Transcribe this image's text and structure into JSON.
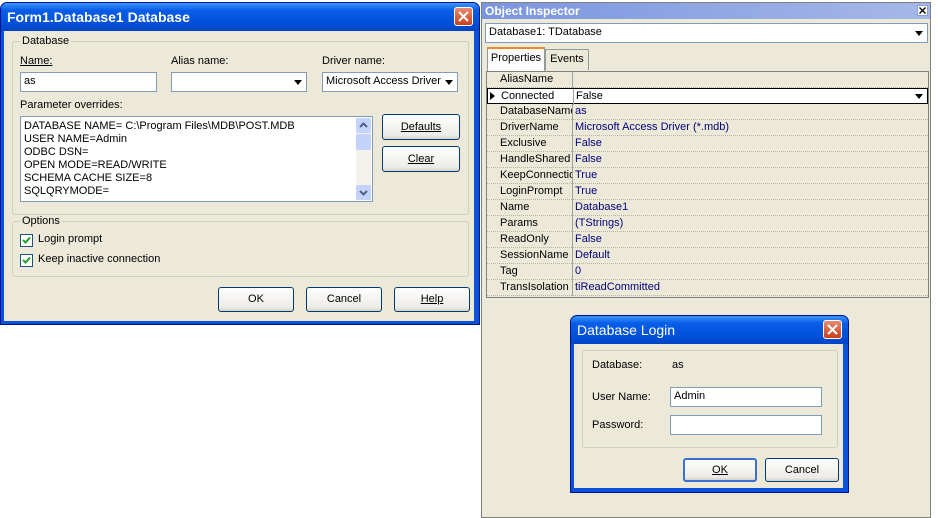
{
  "db_dialog": {
    "title": "Form1.Database1 Database",
    "group_database": "Database",
    "name_label": "Name:",
    "name_value": "as",
    "alias_label": "Alias name:",
    "alias_value": "",
    "driver_label": "Driver name:",
    "driver_value": "Microsoft Access Driver",
    "params_label": "Parameter overrides:",
    "params_lines": [
      "DATABASE NAME= C:\\Program Files\\MDB\\POST.MDB",
      "USER NAME=Admin",
      "ODBC DSN=",
      "OPEN MODE=READ/WRITE",
      "SCHEMA CACHE SIZE=8",
      "SQLQRYMODE="
    ],
    "defaults_label": "Defaults",
    "clear_label": "Clear",
    "group_options": "Options",
    "login_prompt_label": "Login prompt",
    "login_prompt_checked": true,
    "keep_inactive_label": "Keep inactive connection",
    "keep_inactive_checked": true,
    "ok_label": "OK",
    "cancel_label": "Cancel",
    "help_label": "Help"
  },
  "object_inspector": {
    "title": "Object Inspector",
    "component": "Database1: TDatabase",
    "tabs": [
      "Properties",
      "Events"
    ],
    "properties": [
      {
        "name": "AliasName",
        "value": ""
      },
      {
        "name": "Connected",
        "value": "False"
      },
      {
        "name": "DatabaseName",
        "value": "as"
      },
      {
        "name": "DriverName",
        "value": "Microsoft Access Driver (*.mdb)"
      },
      {
        "name": "Exclusive",
        "value": "False"
      },
      {
        "name": "HandleShared",
        "value": "False"
      },
      {
        "name": "KeepConnection",
        "value": "True"
      },
      {
        "name": "LoginPrompt",
        "value": "True"
      },
      {
        "name": "Name",
        "value": "Database1"
      },
      {
        "name": "Params",
        "value": "(TStrings)"
      },
      {
        "name": "ReadOnly",
        "value": "False"
      },
      {
        "name": "SessionName",
        "value": "Default"
      },
      {
        "name": "Tag",
        "value": "0"
      },
      {
        "name": "TransIsolation",
        "value": "tiReadCommitted"
      }
    ]
  },
  "login_dialog": {
    "title": "Database Login",
    "database_label": "Database:",
    "database_value": "as",
    "user_label": "User Name:",
    "user_value": "Admin",
    "password_label": "Password:",
    "password_value": "",
    "ok_label": "OK",
    "cancel_label": "Cancel"
  }
}
